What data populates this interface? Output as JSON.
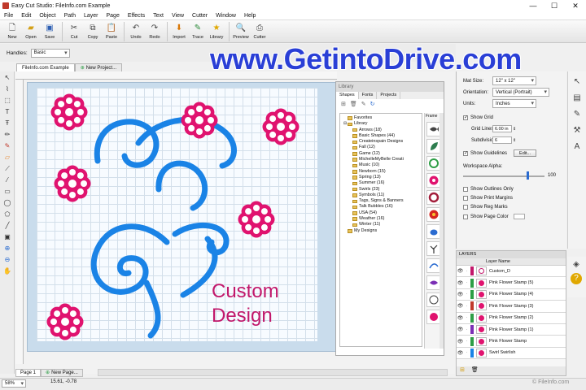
{
  "window": {
    "title": "Easy Cut Studio: FileInfo.com Example",
    "controls": [
      "—",
      "☐",
      "✕"
    ]
  },
  "menu": [
    "File",
    "Edit",
    "Object",
    "Path",
    "Layer",
    "Page",
    "Effects",
    "Text",
    "View",
    "Cutter",
    "Window",
    "Help"
  ],
  "toolbar": [
    {
      "label": "New",
      "icon": "new-icon"
    },
    {
      "label": "Open",
      "icon": "open-icon"
    },
    {
      "label": "Save",
      "icon": "save-icon"
    },
    {
      "label": "Cut",
      "icon": "cut-icon"
    },
    {
      "label": "Copy",
      "icon": "copy-icon"
    },
    {
      "label": "Paste",
      "icon": "paste-icon"
    },
    {
      "label": "Undo",
      "icon": "undo-icon"
    },
    {
      "label": "Redo",
      "icon": "redo-icon"
    },
    {
      "label": "Import",
      "icon": "import-icon"
    },
    {
      "label": "Trace",
      "icon": "trace-icon"
    },
    {
      "label": "Library",
      "icon": "library-icon"
    },
    {
      "label": "Preview",
      "icon": "preview-icon"
    },
    {
      "label": "Cutter",
      "icon": "cutter-icon"
    }
  ],
  "handles": {
    "label": "Handles:",
    "value": "Basic"
  },
  "watermark": "www.GetintoDrive.com",
  "doc_tabs": [
    "FileInfo.com Example",
    "New Project..."
  ],
  "canvas": {
    "text_line1": "Custom",
    "text_line2": "Design",
    "text_color": "#c2186b",
    "swirl_color": "#1a83e6",
    "flower_color": "#e0136f"
  },
  "library": {
    "header": "Library",
    "tabs": [
      "Shapes",
      "Fonts",
      "Projects"
    ],
    "frame_label": "Frame",
    "tree": [
      "Favorites",
      "Library",
      "Arrows (18)",
      "Basic Shapes (44)",
      "Createinspain Designs",
      "Fall (12)",
      "Game (12)",
      "MichelleMyBelle Creati",
      "Music (10)",
      "Newborn (15)",
      "Spring (13)",
      "Summer (16)",
      "Swirls (23)",
      "Symbols (11)",
      "Tags, Signs & Banners",
      "Talk Bubbles (16)",
      "USA (54)",
      "Weather (16)",
      "Winter (11)",
      "My Designs"
    ]
  },
  "properties": {
    "mat_size_label": "Mat Size:",
    "mat_size": "12\" x 12\"",
    "orientation_label": "Orientation:",
    "orientation": "Vertical (Portrait)",
    "units_label": "Units:",
    "units": "Inches",
    "show_grid": "Show Grid",
    "grid_lines_label": "Grid Lines:",
    "grid_lines": "6.00 in",
    "subdivision_label": "Subdivision:",
    "subdivision": "6",
    "show_guidelines": "Show Guidelines",
    "edit_button": "Edit...",
    "alpha_label": "Workspace Alpha:",
    "alpha_value": "100",
    "show_outlines": "Show Outlines Only",
    "show_print_margins": "Show Print Margins",
    "show_reg_marks": "Show Reg Marks",
    "show_page_color": "Show Page Color"
  },
  "layers": {
    "title": "LAYERS",
    "header": "Layer Name",
    "rows": [
      {
        "name": "Custom_D",
        "color": "#c2186b"
      },
      {
        "name": "Pink Flower Stamp (5)",
        "color": "#2e9e46"
      },
      {
        "name": "Pink Flower Stamp (4)",
        "color": "#2e9e46"
      },
      {
        "name": "Pink Flower Stamp (3)",
        "color": "#c0392b"
      },
      {
        "name": "Pink Flower Stamp (2)",
        "color": "#2e9e46"
      },
      {
        "name": "Pink Flower Stamp (1)",
        "color": "#7b2fb5"
      },
      {
        "name": "Pink Flower Stamp",
        "color": "#2e9e46"
      },
      {
        "name": "Swirl Swirlish",
        "color": "#1a83e6"
      }
    ]
  },
  "page_tabs": [
    "Page 1",
    "New Page..."
  ],
  "status": {
    "zoom": "58%",
    "coords": "15.61, -0.78",
    "fileinfo": "© FileInfo.com"
  }
}
